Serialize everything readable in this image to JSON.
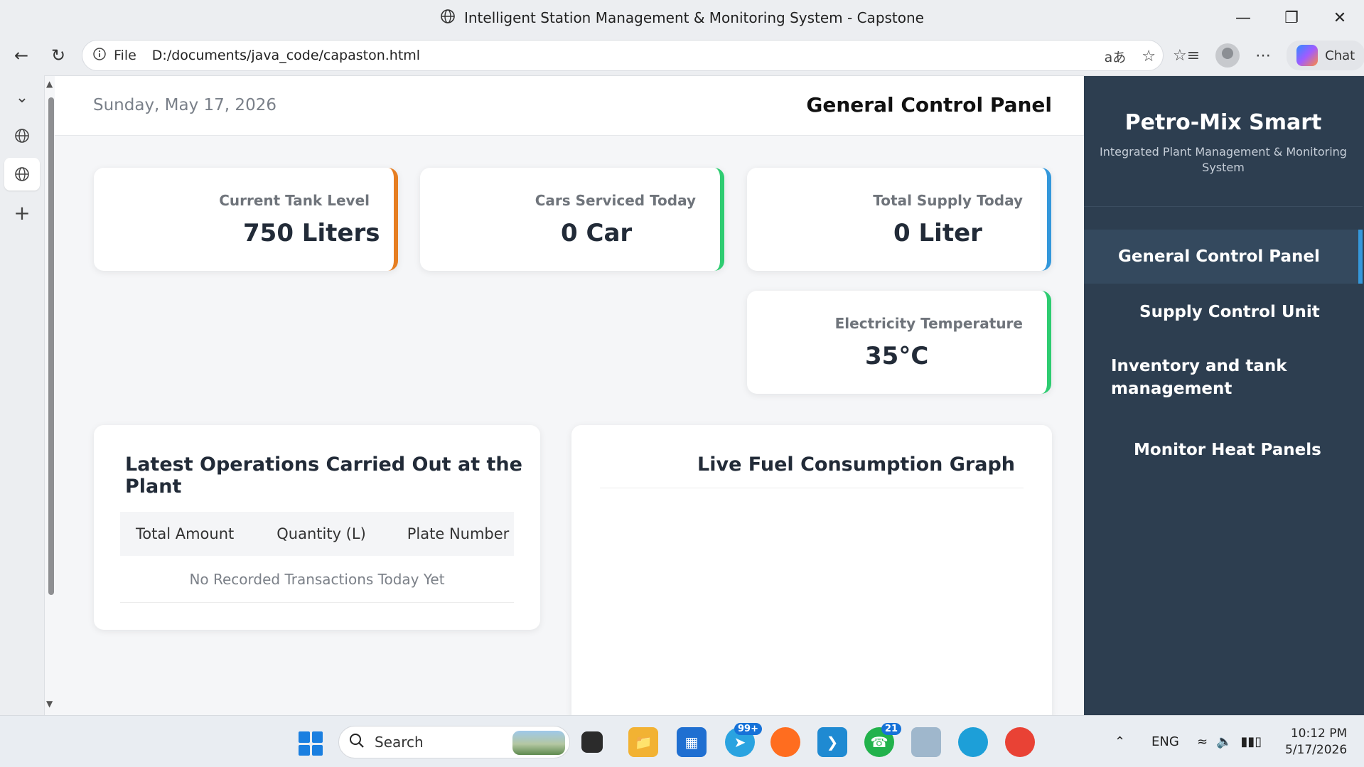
{
  "browser": {
    "tab_title": "Intelligent Station Management & Monitoring System - Capstone",
    "address_scheme": "File",
    "address": "D:/documents/java_code/capaston.html",
    "chat_label": "Chat"
  },
  "page": {
    "date": "Sunday, May 17, 2026",
    "title": "General Control Panel",
    "stats": [
      {
        "label": "Current Tank Level",
        "value": "750 Liters",
        "accent": "#e67e22"
      },
      {
        "label": "Cars Serviced Today",
        "value": "0 Car",
        "accent": "#2ecc71"
      },
      {
        "label": "Total Supply Today",
        "value": "0 Liter",
        "accent": "#3498db"
      },
      {
        "label": "Electricity Temperature",
        "value": "35°C",
        "accent": "#2ecc71"
      }
    ],
    "operations": {
      "title": "Latest Operations Carried Out at the Plant",
      "columns": [
        "Total Amount",
        "Quantity (L)",
        "Plate Number"
      ],
      "empty_text": "No Recorded Transactions Today Yet"
    },
    "graph": {
      "title": "Live Fuel Consumption Graph"
    }
  },
  "sidebar": {
    "brand": "Petro-Mix Smart",
    "subtitle": "Integrated Plant Management & Monitoring System",
    "items": [
      {
        "label": "General Control Panel",
        "active": true
      },
      {
        "label": "Supply Control Unit",
        "active": false
      },
      {
        "label": "Inventory and tank management",
        "active": false
      },
      {
        "label": "Monitor Heat Panels",
        "active": false
      }
    ],
    "bg_color": "#2d3e50"
  },
  "taskbar": {
    "search_placeholder": "Search",
    "telegram_badge": "99+",
    "whatsapp_badge": "21",
    "language": "ENG",
    "time": "10:12 PM",
    "date": "5/17/2026"
  }
}
